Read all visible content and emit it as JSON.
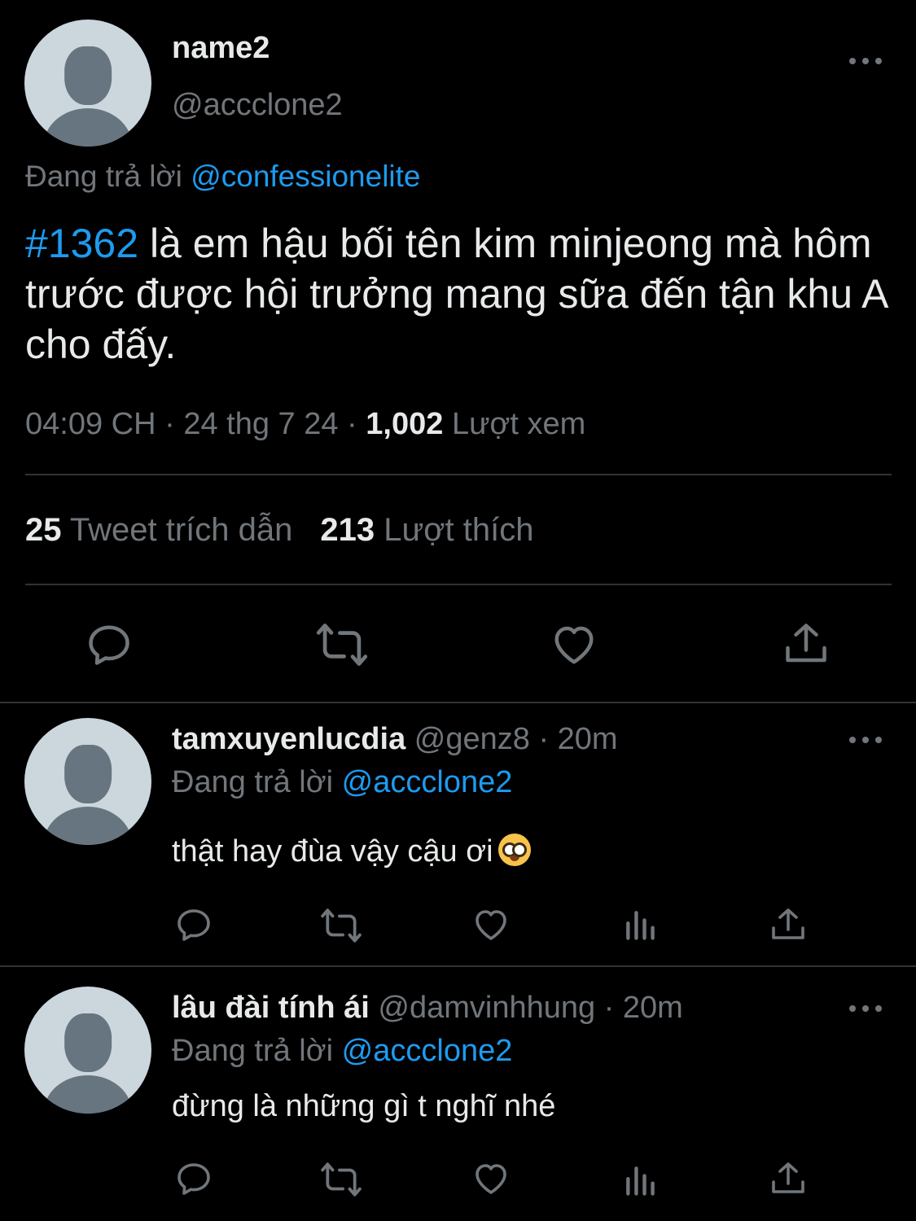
{
  "main_tweet": {
    "display_name": "name2",
    "handle": "@accclone2",
    "reply_prefix": "Đang trả lời",
    "reply_to": "@confessionelite",
    "hashtag": "#1362",
    "text": " là em hậu bối tên kim minjeong mà hôm trước được hội trưởng mang sữa đến tận khu A cho đấy.",
    "time": "04:09 CH",
    "date": "24 thg 7 24",
    "sep": " · ",
    "views_count": "1,002",
    "views_label": "Lượt xem",
    "quote_count": "25",
    "quote_label": "Tweet trích dẫn",
    "like_count": "213",
    "like_label": "Lượt thích"
  },
  "replies": [
    {
      "display_name": "tamxuyenlucdia",
      "handle": "@genz8 · 20m",
      "reply_prefix": "Đang trả lời",
      "reply_to": "@accclone2",
      "text": "thật hay đùa vậy cậu ơi"
    },
    {
      "display_name": "lâu đài tính ái",
      "handle": "@damvinhhung · 20m",
      "reply_prefix": "Đang trả lời",
      "reply_to": "@accclone2",
      "text": "đừng là những gì t nghĩ nhé"
    }
  ],
  "icons": {
    "reply": "reply-icon",
    "retweet": "retweet-icon",
    "like": "heart-icon",
    "analytics": "analytics-icon",
    "share": "share-icon",
    "more": "more-icon",
    "emoji": "nerd-face-emoji"
  },
  "colors": {
    "background": "#000000",
    "text": "#e7e9ea",
    "secondary": "#71767b",
    "link": "#1d9bf0",
    "divider": "#2f3336"
  }
}
